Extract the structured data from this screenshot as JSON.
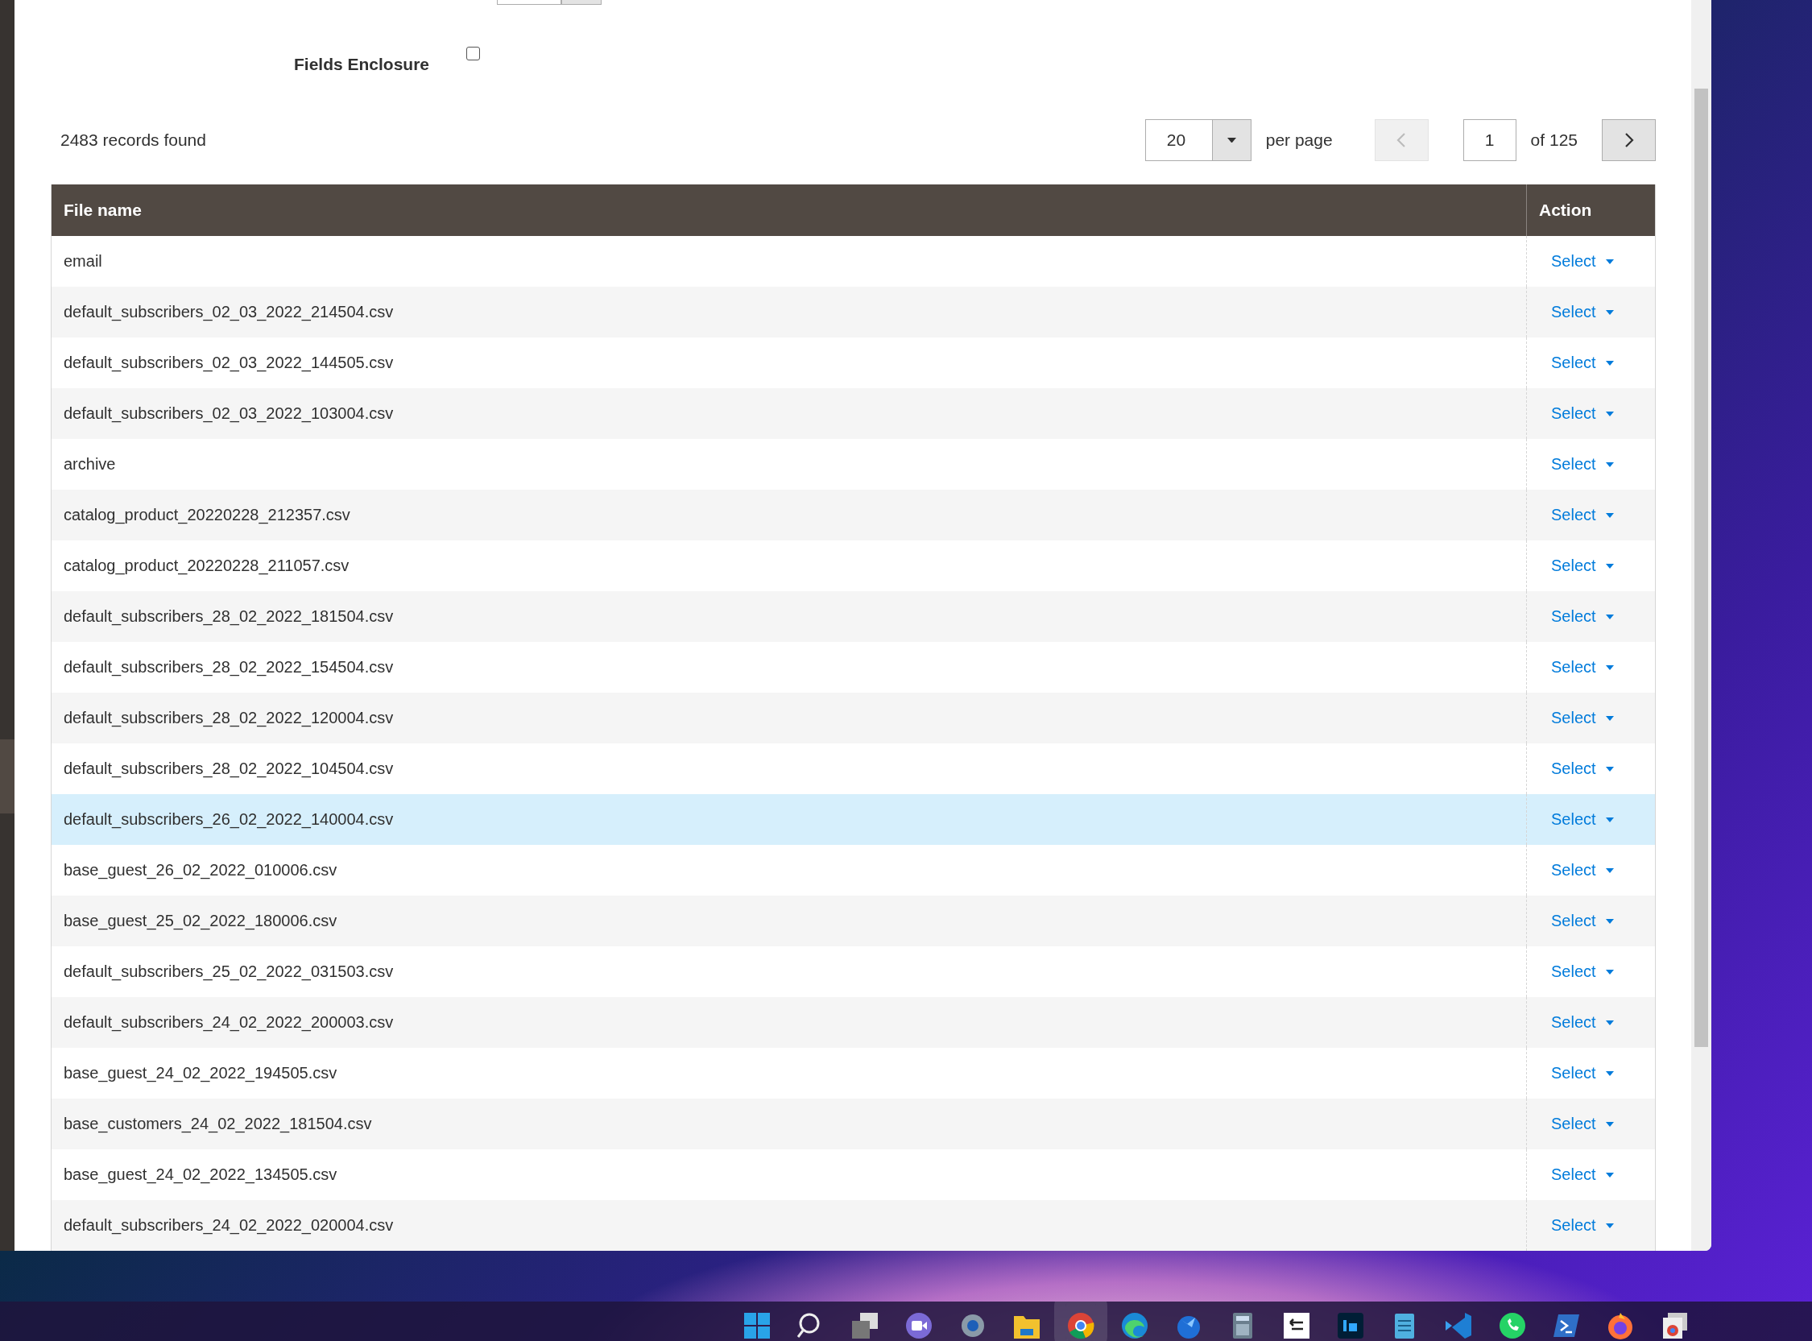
{
  "fields_enclosure": {
    "label": "Fields Enclosure",
    "checked": false
  },
  "records": "2483 records found",
  "pager": {
    "per_page": "20",
    "per_page_label": "per page",
    "page": "1",
    "of": "of 125",
    "prev_disabled": true,
    "next_disabled": false
  },
  "table": {
    "columns": [
      "File name",
      "Action"
    ],
    "rows": [
      {
        "name": "email",
        "action": "Select",
        "highlighted": false
      },
      {
        "name": "default_subscribers_02_03_2022_214504.csv",
        "action": "Select",
        "highlighted": false
      },
      {
        "name": "default_subscribers_02_03_2022_144505.csv",
        "action": "Select",
        "highlighted": false
      },
      {
        "name": "default_subscribers_02_03_2022_103004.csv",
        "action": "Select",
        "highlighted": false
      },
      {
        "name": "archive",
        "action": "Select",
        "highlighted": false
      },
      {
        "name": "catalog_product_20220228_212357.csv",
        "action": "Select",
        "highlighted": false
      },
      {
        "name": "catalog_product_20220228_211057.csv",
        "action": "Select",
        "highlighted": false
      },
      {
        "name": "default_subscribers_28_02_2022_181504.csv",
        "action": "Select",
        "highlighted": false
      },
      {
        "name": "default_subscribers_28_02_2022_154504.csv",
        "action": "Select",
        "highlighted": false
      },
      {
        "name": "default_subscribers_28_02_2022_120004.csv",
        "action": "Select",
        "highlighted": false
      },
      {
        "name": "default_subscribers_28_02_2022_104504.csv",
        "action": "Select",
        "highlighted": false
      },
      {
        "name": "default_subscribers_26_02_2022_140004.csv",
        "action": "Select",
        "highlighted": true
      },
      {
        "name": "base_guest_26_02_2022_010006.csv",
        "action": "Select",
        "highlighted": false
      },
      {
        "name": "base_guest_25_02_2022_180006.csv",
        "action": "Select",
        "highlighted": false
      },
      {
        "name": "default_subscribers_25_02_2022_031503.csv",
        "action": "Select",
        "highlighted": false
      },
      {
        "name": "default_subscribers_24_02_2022_200003.csv",
        "action": "Select",
        "highlighted": false
      },
      {
        "name": "base_guest_24_02_2022_194505.csv",
        "action": "Select",
        "highlighted": false
      },
      {
        "name": "base_customers_24_02_2022_181504.csv",
        "action": "Select",
        "highlighted": false
      },
      {
        "name": "base_guest_24_02_2022_134505.csv",
        "action": "Select",
        "highlighted": false
      },
      {
        "name": "default_subscribers_24_02_2022_020004.csv",
        "action": "Select",
        "highlighted": false
      }
    ]
  },
  "taskbar": {
    "apps": [
      {
        "kind": "start",
        "active": false
      },
      {
        "kind": "search",
        "active": false
      },
      {
        "kind": "taskview",
        "active": false
      },
      {
        "kind": "meet",
        "active": false
      },
      {
        "kind": "settings",
        "active": false
      },
      {
        "kind": "folder",
        "active": false
      },
      {
        "kind": "chrome",
        "active": true
      },
      {
        "kind": "edge",
        "active": false
      },
      {
        "kind": "thunderbird",
        "active": false
      },
      {
        "kind": "calculator",
        "active": false
      },
      {
        "kind": "remote",
        "active": false
      },
      {
        "kind": "photoshop",
        "active": false
      },
      {
        "kind": "notepad",
        "active": false
      },
      {
        "kind": "vscode",
        "active": false
      },
      {
        "kind": "whatsapp",
        "active": false
      },
      {
        "kind": "terminal",
        "active": false
      },
      {
        "kind": "firefox",
        "active": false
      },
      {
        "kind": "chrome-stack",
        "active": false
      }
    ]
  }
}
